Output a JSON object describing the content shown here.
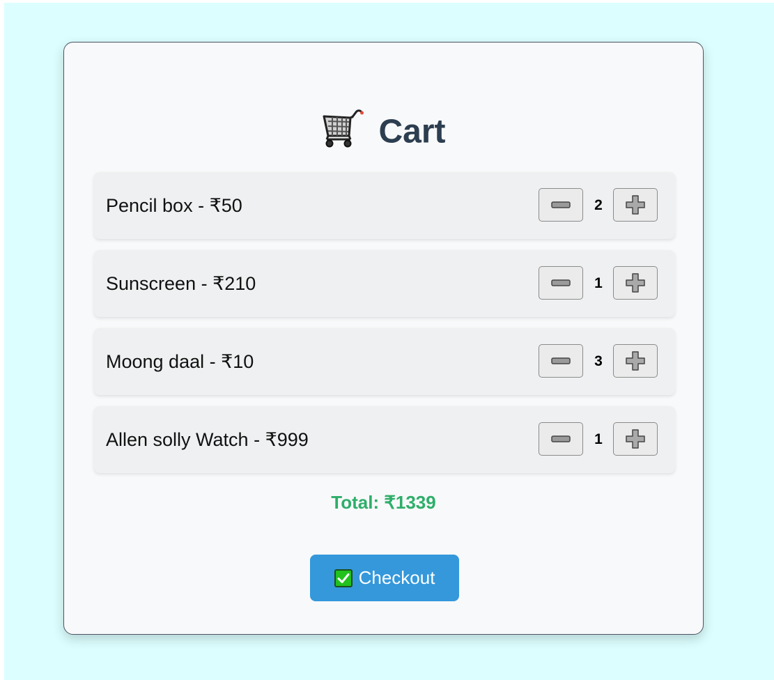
{
  "cart": {
    "title": "Cart",
    "items": [
      {
        "label": "Pencil box - ₹50",
        "qty": "2"
      },
      {
        "label": "Sunscreen - ₹210",
        "qty": "1"
      },
      {
        "label": "Moong daal - ₹10",
        "qty": "3"
      },
      {
        "label": "Allen solly Watch - ₹999",
        "qty": "1"
      }
    ],
    "total": "Total: ₹1339",
    "checkout_label": "Checkout"
  },
  "icons": {
    "title": "shopping-cart-icon",
    "decrement": "minus-icon",
    "increment": "plus-icon",
    "checkout": "check-mark-icon"
  },
  "colors": {
    "page_background": "#dcfefe",
    "card_background": "#f8f9fa",
    "title": "#2c3e50",
    "total": "#2eae6a",
    "checkout_button": "#3498db"
  }
}
